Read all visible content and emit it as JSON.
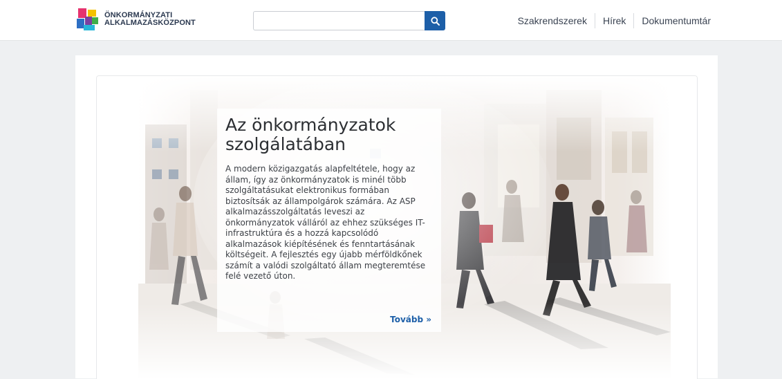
{
  "header": {
    "logo_line1": "ÖNKORMÁNYZATI",
    "logo_line2": "ALKALMAZÁSKÖZPONT",
    "search": {
      "value": "",
      "placeholder": ""
    },
    "nav": [
      {
        "label": "Szakrendszerek"
      },
      {
        "label": "Hírek"
      },
      {
        "label": "Dokumentumtár"
      }
    ]
  },
  "hero": {
    "title": "Az önkormányzatok szolgálatában",
    "body": "A modern közigazgatás alapfeltétele, hogy az állam, így az önkormányzatok is minél több szolgáltatásukat elektronikus formában biztosítsák az állampolgárok számára. Az ASP alkalmazásszolgáltatás leveszi az önkormányzatok válláról az ehhez szükséges IT-infrastruktúra és a hozzá kapcsolódó alkalmazások kiépítésének és fenntartásának költségeit. A fejlesztés egy újabb mérföldkőnek számít a valódi szolgáltató állam megteremtése felé vezető úton.",
    "more_label": "Tovább »"
  },
  "colors": {
    "accent": "#1d5fa8",
    "logo_pink": "#e6336f",
    "logo_yellow": "#f5c200",
    "logo_blue": "#2d6fc4",
    "logo_cyan": "#26b6d8",
    "logo_purple": "#7b3fa0",
    "logo_green": "#3fae49"
  },
  "icons": {
    "search": "search-icon",
    "logo": "logo-icon"
  }
}
